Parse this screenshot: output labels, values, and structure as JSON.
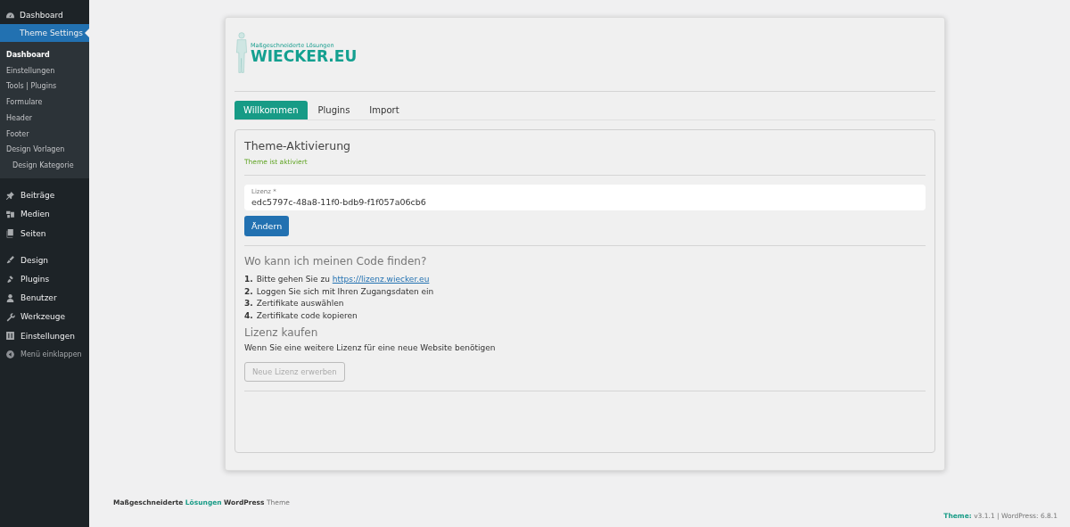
{
  "sidebar": {
    "top_items": [
      {
        "label": "Dashboard",
        "selected": false
      },
      {
        "label": "Theme Settings",
        "selected": true
      }
    ],
    "submenu": [
      {
        "label": "Dashboard",
        "selected": true
      },
      {
        "label": "Einstellungen",
        "selected": false
      },
      {
        "label": "Tools | Plugins",
        "selected": false
      },
      {
        "label": "Formulare",
        "selected": false
      },
      {
        "label": "Header",
        "selected": false
      },
      {
        "label": "Footer",
        "selected": false
      },
      {
        "label": "Design Vorlagen",
        "selected": false,
        "children": [
          {
            "label": "Design Kategorie",
            "selected": false
          }
        ]
      }
    ],
    "groups": [
      [
        {
          "label": "Beiträge"
        },
        {
          "label": "Medien"
        },
        {
          "label": "Seiten"
        }
      ],
      [
        {
          "label": "Design"
        },
        {
          "label": "Plugins"
        },
        {
          "label": "Benutzer"
        },
        {
          "label": "Werkzeuge"
        },
        {
          "label": "Einstellungen"
        },
        {
          "label": "Menü einklappen",
          "kind": "collapse"
        }
      ]
    ]
  },
  "logo": {
    "tagline": "Maßgeschneiderte Lösungen",
    "name": "WIECKER.EU"
  },
  "tabs": [
    {
      "label": "Willkommen",
      "selected": true
    },
    {
      "label": "Plugins",
      "selected": false
    },
    {
      "label": "Import",
      "selected": false
    }
  ],
  "panel": {
    "title": "Theme-Aktivierung",
    "status": "Theme ist aktiviert",
    "license_field": {
      "label": "Lizenz *",
      "value": "edc5797c-48a8-11f0-bdb9-f1f057a06cb6"
    },
    "change_button": "Ändern",
    "help_title": "Wo kann ich meinen Code finden?",
    "steps": [
      {
        "number": "1.",
        "text": "Bitte gehen Sie zu",
        "link": "https://lizenz.wiecker.eu"
      },
      {
        "number": "2.",
        "text": "Loggen Sie sich mit Ihren Zugangsdaten ein"
      },
      {
        "number": "3.",
        "text": "Zertifikate auswählen"
      },
      {
        "number": "4.",
        "text": "Zertifikate code kopieren"
      }
    ],
    "buy_title": "Lizenz kaufen",
    "buy_text": "Wenn Sie eine weitere Lizenz für eine neue Website benötigen",
    "buy_button": {
      "label": "Neue Lizenz erwerben",
      "disabled": true
    }
  },
  "footer": {
    "credit": [
      {
        "text": "Maßgeschneiderte",
        "kind": "bold"
      },
      {
        "text": "Lösungen",
        "kind": "accent"
      },
      {
        "text": "WordPress",
        "kind": "bold"
      },
      {
        "text": "Theme",
        "kind": "muted"
      }
    ],
    "version": [
      {
        "text": "Theme:",
        "kind": "accent"
      },
      {
        "text": "v3.1.1  |  WordPress: 6.8.1",
        "kind": "muted"
      }
    ]
  }
}
